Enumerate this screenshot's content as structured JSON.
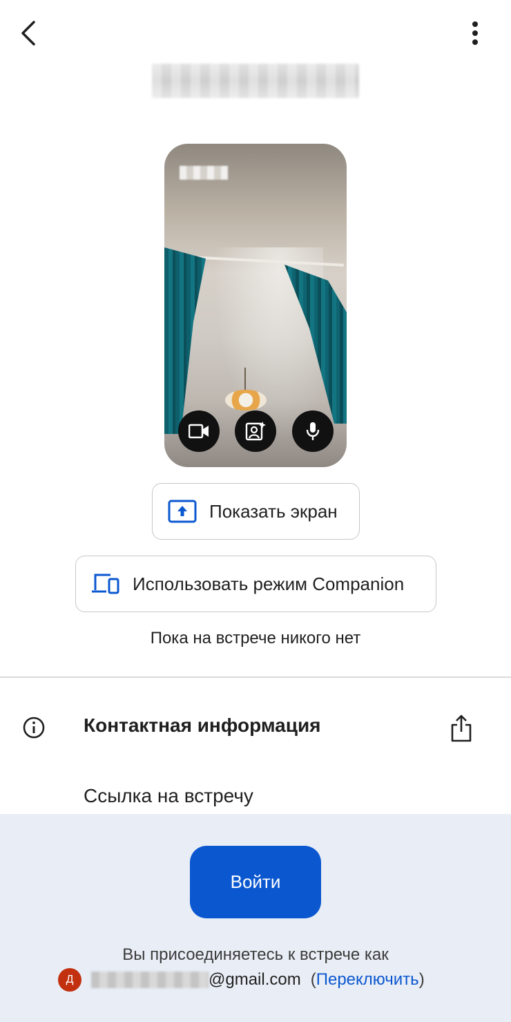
{
  "top_bar": {
    "back_icon": "chevron-left-icon",
    "more_icon": "more-vert-icon",
    "meeting_code": "xxx-xxxx-xxx"
  },
  "preview": {
    "participant_name": "Вы",
    "controls": [
      {
        "icon": "video-camera-icon"
      },
      {
        "icon": "effects-icon"
      },
      {
        "icon": "microphone-icon"
      }
    ]
  },
  "actions": {
    "share_screen_label": "Показать экран",
    "companion_label": "Использовать режим Companion"
  },
  "status": {
    "empty_meeting_text": "Пока на встрече никого нет"
  },
  "info": {
    "title": "Контактная информация",
    "link_label": "Ссылка на встречу"
  },
  "join": {
    "button_label": "Войти",
    "joining_as_text": "Вы присоединяетесь к встрече как",
    "avatar_letter": "Д",
    "email_local": "xxxxxxxxxxxx",
    "email_domain": "@gmail.com",
    "paren_open": "(",
    "switch_label": "Переключить",
    "paren_close": ")"
  },
  "colors": {
    "accent": "#0b57d0",
    "bottom_sheet_bg": "#e9eef6",
    "avatar_bg": "#c2300f"
  }
}
